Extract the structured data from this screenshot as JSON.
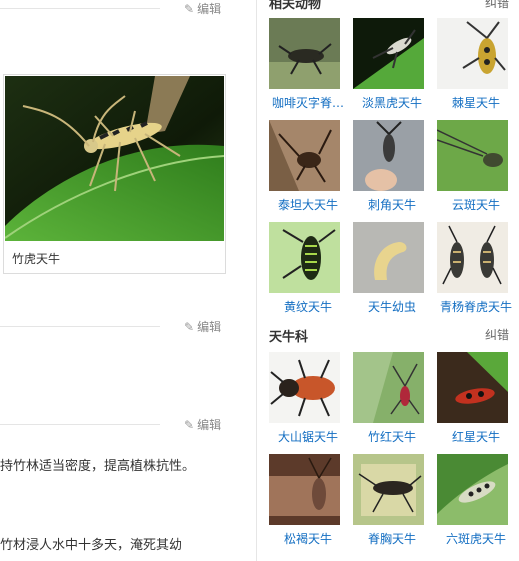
{
  "left": {
    "edit_label": "编辑",
    "figure_caption": "竹虎天牛",
    "text_line_1": "持竹林适当密度，提高植株抗性。",
    "text_line_2": "竹材浸人水中十多天，淹死其幼"
  },
  "related": {
    "title": "相关动物",
    "correct_link": "纠错",
    "items": [
      {
        "label": "咖啡灭字脊…"
      },
      {
        "label": "淡黑虎天牛"
      },
      {
        "label": "棘星天牛"
      },
      {
        "label": "泰坦大天牛"
      },
      {
        "label": "刺角天牛"
      },
      {
        "label": "云斑天牛"
      },
      {
        "label": "黄纹天牛"
      },
      {
        "label": "天牛幼虫"
      },
      {
        "label": "青杨脊虎天牛"
      }
    ]
  },
  "family": {
    "title": "天牛科",
    "correct_link": "纠错",
    "items": [
      {
        "label": "大山锯天牛"
      },
      {
        "label": "竹红天牛"
      },
      {
        "label": "红星天牛"
      },
      {
        "label": "松褐天牛"
      },
      {
        "label": "脊胸天牛"
      },
      {
        "label": "六斑虎天牛"
      }
    ]
  },
  "colors": {
    "link": "#136ec2",
    "leaf_green": "#3f9a2a",
    "divider": "#e5e5e5"
  }
}
